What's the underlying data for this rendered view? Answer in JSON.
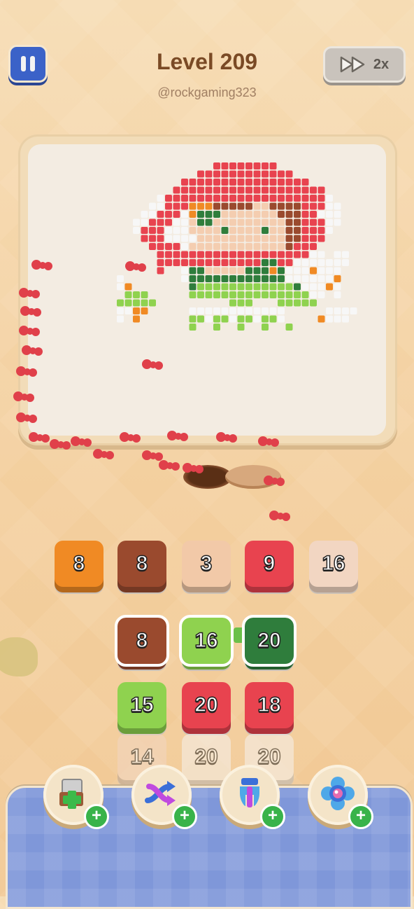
{
  "header": {
    "title": "Level 209",
    "username": "@rockgaming323",
    "speed_label": "2x"
  },
  "queue_tiles": [
    {
      "label": "8",
      "color": "#f08a24"
    },
    {
      "label": "8",
      "color": "#9a4a2e"
    },
    {
      "label": "3",
      "color": "#f2c9a8"
    },
    {
      "label": "9",
      "color": "#e8434f"
    },
    {
      "label": "16",
      "color": "#f2d6c2"
    }
  ],
  "grid_tiles": [
    {
      "label": "8",
      "color": "#9a4a2e",
      "state": "selected"
    },
    {
      "label": "16",
      "color": "#8fd24f",
      "state": "selected"
    },
    {
      "label": "20",
      "color": "#2f7d3c",
      "state": "selected"
    },
    {
      "label": "15",
      "color": "#8fd24f",
      "state": "normal"
    },
    {
      "label": "20",
      "color": "#e8434f",
      "state": "normal"
    },
    {
      "label": "18",
      "color": "#e8434f",
      "state": "normal"
    },
    {
      "label": "14",
      "color": "#f2d6c2",
      "state": "dim"
    },
    {
      "label": "20",
      "color": "#f5f2ee",
      "state": "dim"
    },
    {
      "label": "20",
      "color": "#f5f2ee",
      "state": "dim"
    }
  ],
  "boosters": [
    {
      "icon": "add-box-icon"
    },
    {
      "icon": "shuffle-arrows-icon"
    },
    {
      "icon": "magnet-claw-icon"
    },
    {
      "icon": "flower-button-icon"
    }
  ],
  "colors": {
    "red": "#e8434f",
    "white": "#f7f7f7",
    "skin": "#f4cdb0",
    "brown": "#9a4a2e",
    "lime": "#8fd24f",
    "dark_green": "#2f7d3c",
    "orange": "#f08a24",
    "ant": "#e0404a"
  }
}
